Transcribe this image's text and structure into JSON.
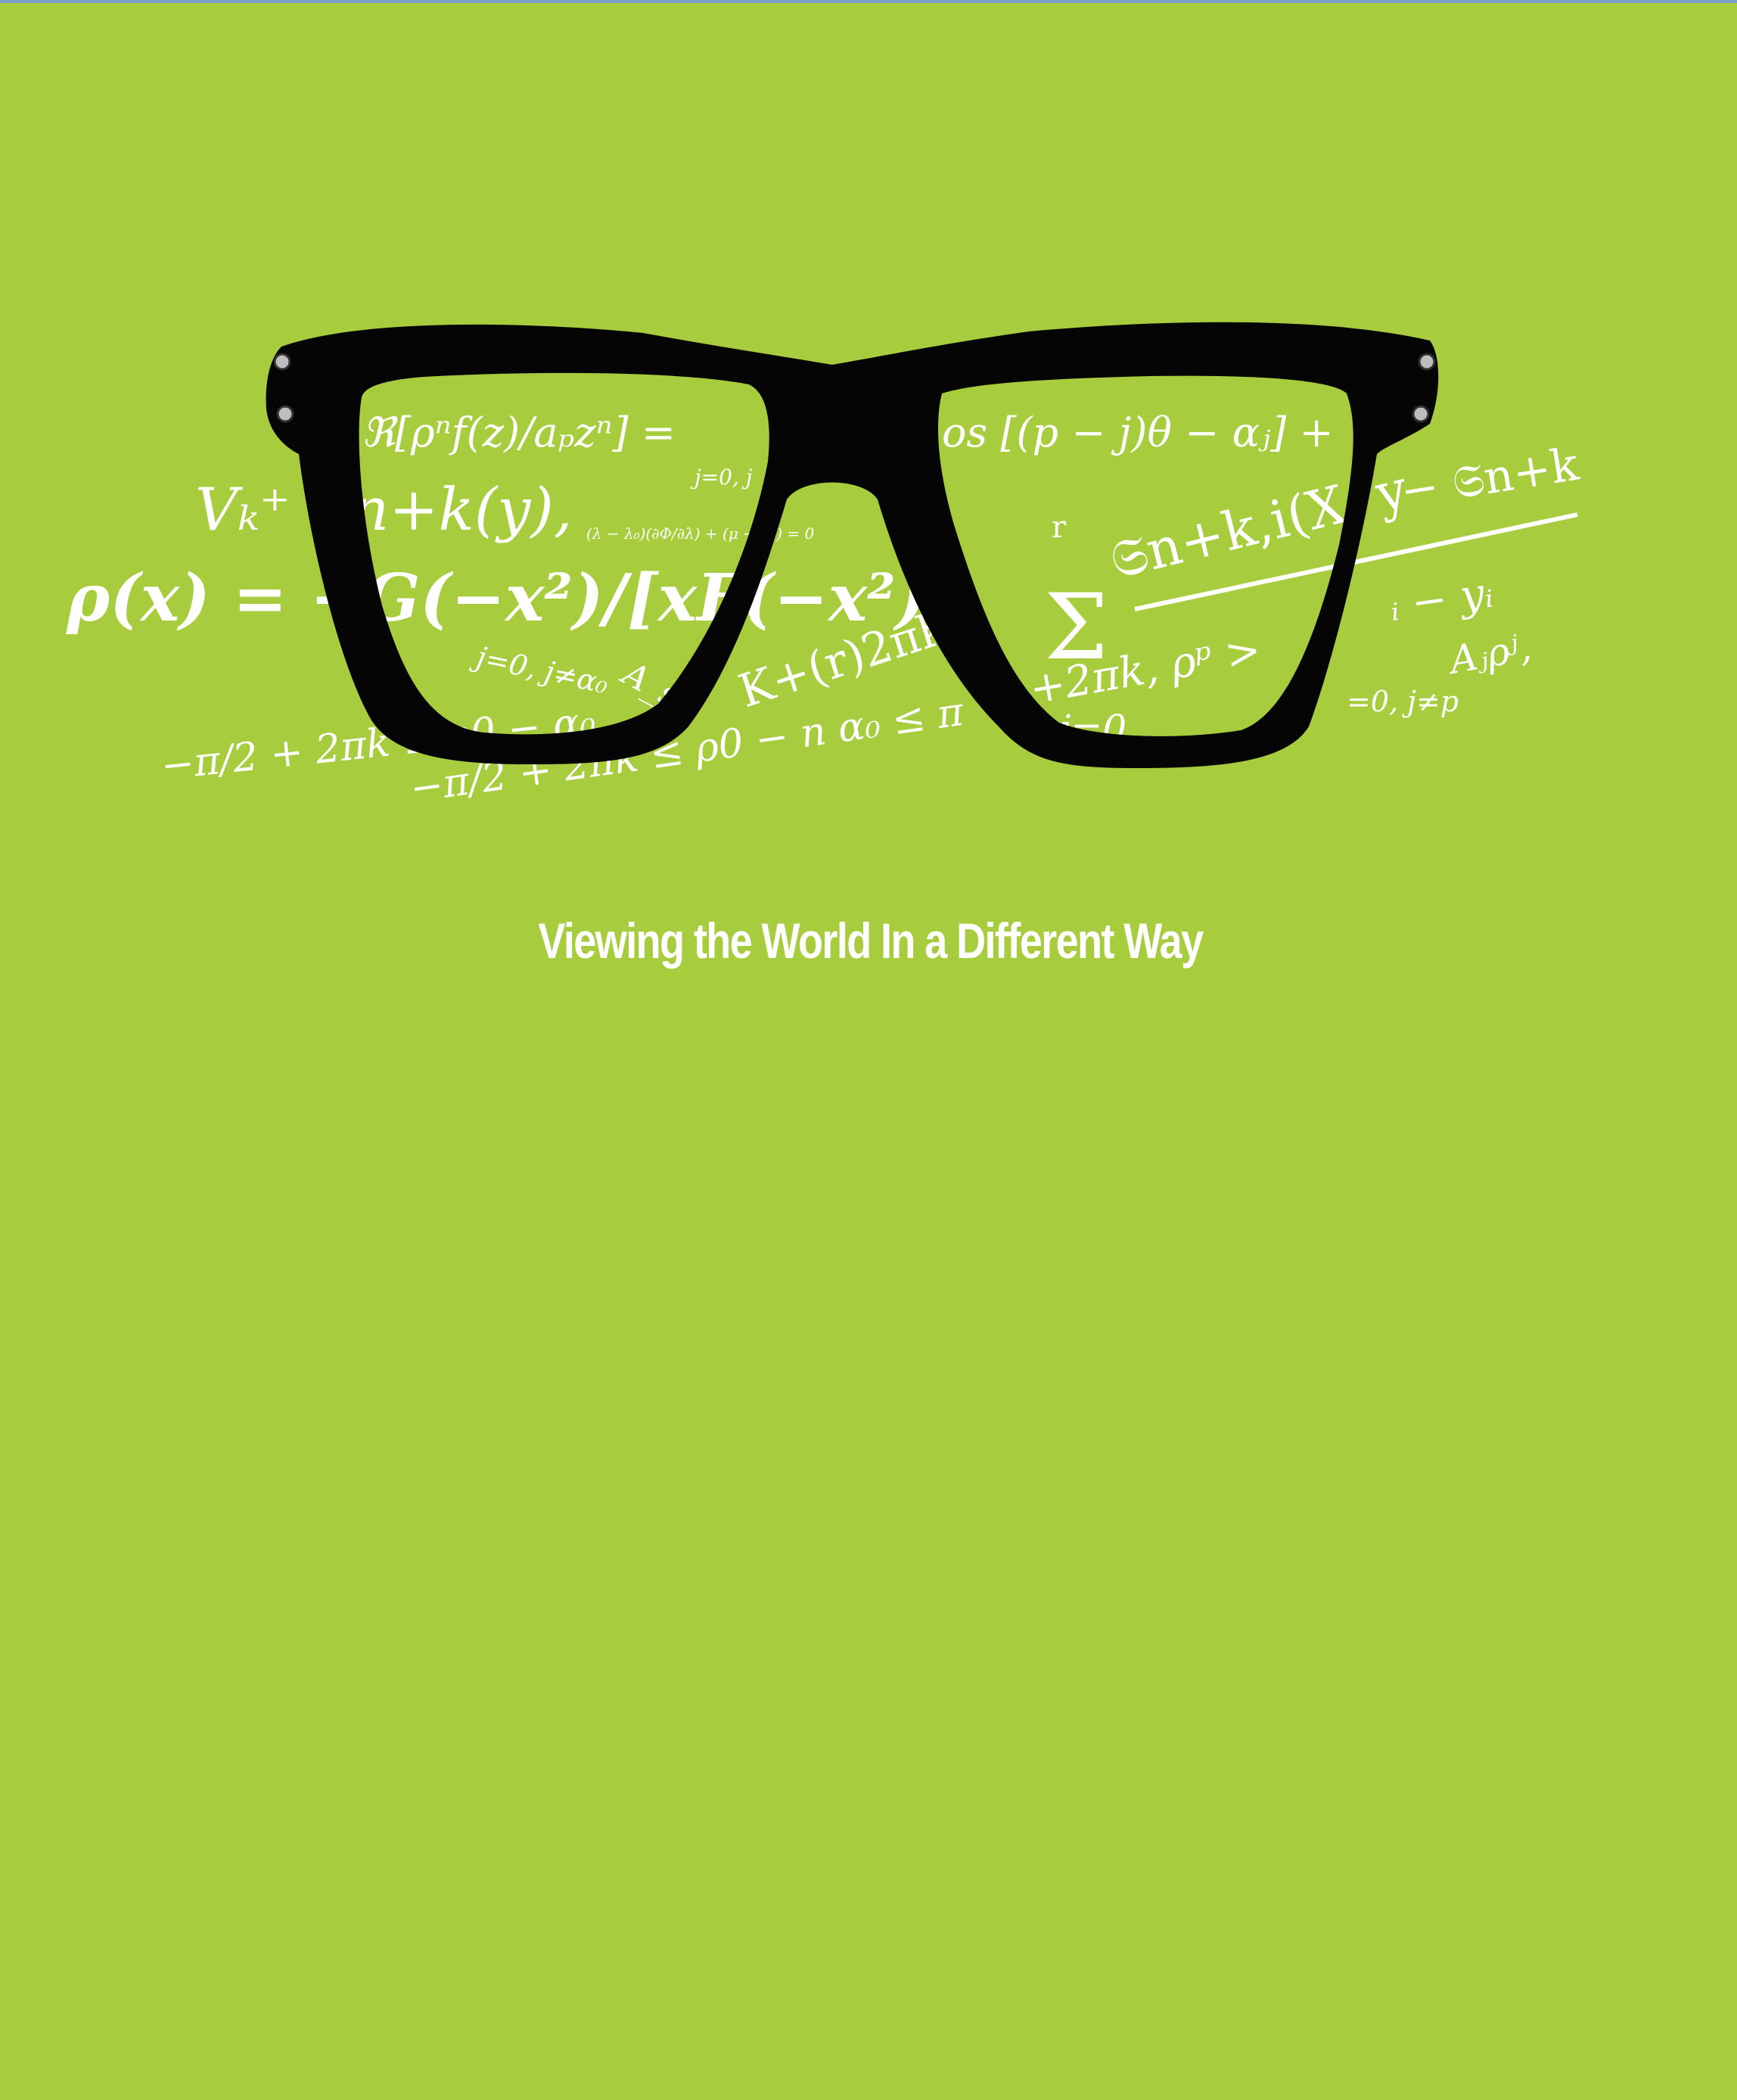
{
  "cover": {
    "background_color": "#a7cc3e",
    "tagline": "Viewing the World In a Different Way"
  },
  "illustration": {
    "name": "glasses-with-formulas",
    "frame_color": "#050505",
    "formula_color": "#ffffff",
    "formulas": [
      "ℜ[ρⁿf(z)/aₚzⁿ] =",
      "j=0, j",
      "os [(p − j)θ − αⱼ] +",
      "− 𝔖n+k",
      "Vₖ⁺ ( n+k(y),",
      "(λ − λ₀)(∂Φ/∂λ) + (μ − μ₀) = 0",
      "𝔖n+k,i(X, y",
      "ρ(x) = −G(−x²)/[xF(−x²)].",
      "Σ",
      "r",
      "ᵢ − yᵢ",
      "j=0, j≠α₀",
      "A_sρ",
      "K+(r)2πk,y",
      "+2πk,   ρᵖ >",
      "Aⱼρʲ,",
      "=0, j≠p",
      "−π/2 + 2πk ≤ ρ0 − α₀",
      "−π/2 + 2πk ≤ ρ0 − n α₀ ≤ π",
      "j=0"
    ]
  }
}
